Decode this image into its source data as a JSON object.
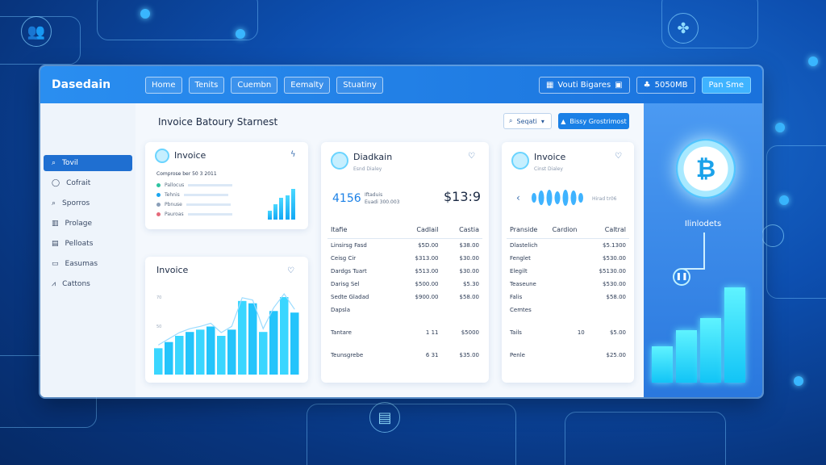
{
  "app": {
    "title": "Dasedain"
  },
  "nav": [
    "Home",
    "Tenits",
    "Cuembn",
    "Eemalty",
    "Stuatiny"
  ],
  "top_right": {
    "btn1": "Vouti Bigares",
    "btn2": "5050MB",
    "btn3": "Pan Sme"
  },
  "page": {
    "title": "Invoice Batoury Starnest",
    "search": "Seqati",
    "report": "Bissy Grostrimost"
  },
  "sidebar": [
    "Tovil",
    "Cofrait",
    "Sporros",
    "Prolage",
    "Pelloats",
    "Easumas",
    "Cattons"
  ],
  "card1": {
    "title": "Invoice",
    "subtitle": "Comprose ber 50 3 2011",
    "legend": [
      "Pallocus",
      "Tehnis",
      "Pbnuse",
      "Pauroas"
    ],
    "bars": [
      0.3,
      0.5,
      0.7,
      0.8,
      1.0
    ]
  },
  "card2": {
    "title": "Invoice",
    "y_ticks": [
      "70",
      "50"
    ],
    "bars": [
      0.34,
      0.42,
      0.5,
      0.55,
      0.58,
      0.62,
      0.5,
      0.58,
      0.95,
      0.92,
      0.55,
      0.82,
      1.0,
      0.8
    ]
  },
  "card3": {
    "title": "Diadkain",
    "subtitle": "Esnd Dialey",
    "stat": "4156",
    "stat_sub1": "Iftaduis",
    "stat_sub2": "Euadi 300.003",
    "total": "$13:9",
    "headers": [
      "Itafie",
      "Cadlail",
      "Castia"
    ],
    "rows": [
      [
        "Linsirsg Fasd",
        "$5D.00",
        "$38.00"
      ],
      [
        "Ceisg Cir",
        "$313.00",
        "$30.00"
      ],
      [
        "Dardgs Tuart",
        "$513.00",
        "$30.00"
      ],
      [
        "Darisg Sel",
        "$500.00",
        "$5.30"
      ],
      [
        "Sedte Gladad",
        "$900.00",
        "$58.00"
      ],
      [
        "Dapsla",
        "",
        ""
      ],
      [
        "Tantare",
        "1 11",
        "$5000"
      ],
      [
        "Teunsgrebe",
        "6 31",
        "$35.00"
      ]
    ]
  },
  "card4": {
    "title": "Invoice",
    "subtitle": "Cinst Dialey",
    "wave_label": "Hirad tr06",
    "headers": [
      "Pranside",
      "Cardion",
      "Caltral"
    ],
    "rows": [
      [
        "Dlastelich",
        "",
        "$5.1300"
      ],
      [
        "Fenglet",
        "",
        "$530.00"
      ],
      [
        "Elegilt",
        "",
        "$5130.00"
      ],
      [
        "Teaseune",
        "",
        "$530.00"
      ],
      [
        "Falis",
        "",
        "$58.00"
      ],
      [
        "Cemtes",
        "",
        ""
      ],
      [
        "Tails",
        "10",
        "$5.00"
      ],
      [
        "Penle",
        "",
        "$25.00"
      ]
    ]
  },
  "right_panel": {
    "label": "Ilinlodets",
    "coin_symbol": "₿",
    "bars": [
      0.38,
      0.55,
      0.68,
      1.0
    ]
  },
  "colors": {
    "accent": "#1a80e6",
    "cyan": "#12c4f6",
    "background": "#0d4fb0"
  }
}
